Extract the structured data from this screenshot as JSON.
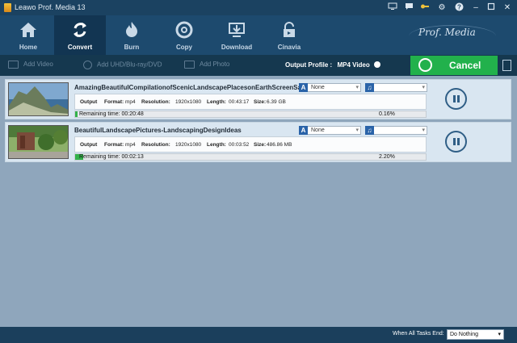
{
  "window": {
    "title": "Leawo Prof. Media 13",
    "controls": [
      "monitor-icon",
      "chat-icon",
      "key-icon",
      "gear-icon",
      "help-icon",
      "minimize-icon",
      "maximize-icon",
      "close-icon"
    ]
  },
  "nav": {
    "items": [
      {
        "label": "Home",
        "icon": "home-icon"
      },
      {
        "label": "Convert",
        "icon": "convert-icon",
        "active": true
      },
      {
        "label": "Burn",
        "icon": "burn-icon"
      },
      {
        "label": "Copy",
        "icon": "copy-icon"
      },
      {
        "label": "Download",
        "icon": "download-icon"
      },
      {
        "label": "Cinavia",
        "icon": "cinavia-icon"
      }
    ],
    "brand": "Prof. Media"
  },
  "toolbar": {
    "add_video": "Add Video",
    "add_uhd": "Add UHD/Blu-ray/DVD",
    "add_photo": "Add Photo",
    "output_profile_label": "Output Profile :",
    "output_profile_value": "MP4 Video",
    "cancel_label": "Cancel"
  },
  "tasks": [
    {
      "file_name": "AmazingBeautifulCompilationofScenicLandscapePlacesonEarthScreenSav",
      "subtitle": "None",
      "audio": "",
      "output_label": "Output",
      "format_label": "Format:",
      "format": "mp4",
      "resolution_label": "Resolution:",
      "resolution": "1920x1080",
      "length_label": "Length:",
      "length": "00:43:17",
      "size_label": "Size:",
      "size": "6.39 GB",
      "remaining_label": "Remaining time:",
      "remaining": "00:20:48",
      "percent": "0.16%",
      "progress": 0.0016
    },
    {
      "file_name": "BeautifulLandscapePictures-LandscapingDesignIdeas",
      "subtitle": "None",
      "audio": "",
      "output_label": "Output",
      "format_label": "Format:",
      "format": "mp4",
      "resolution_label": "Resolution:",
      "resolution": "1920x1080",
      "length_label": "Length:",
      "length": "00:03:52",
      "size_label": "Size:",
      "size": "486.86 MB",
      "remaining_label": "Remaining time:",
      "remaining": "00:02:13",
      "percent": "2.20%",
      "progress": 0.022
    }
  ],
  "footer": {
    "end_label": "When All Tasks End:",
    "end_value": "Do Nothing"
  }
}
